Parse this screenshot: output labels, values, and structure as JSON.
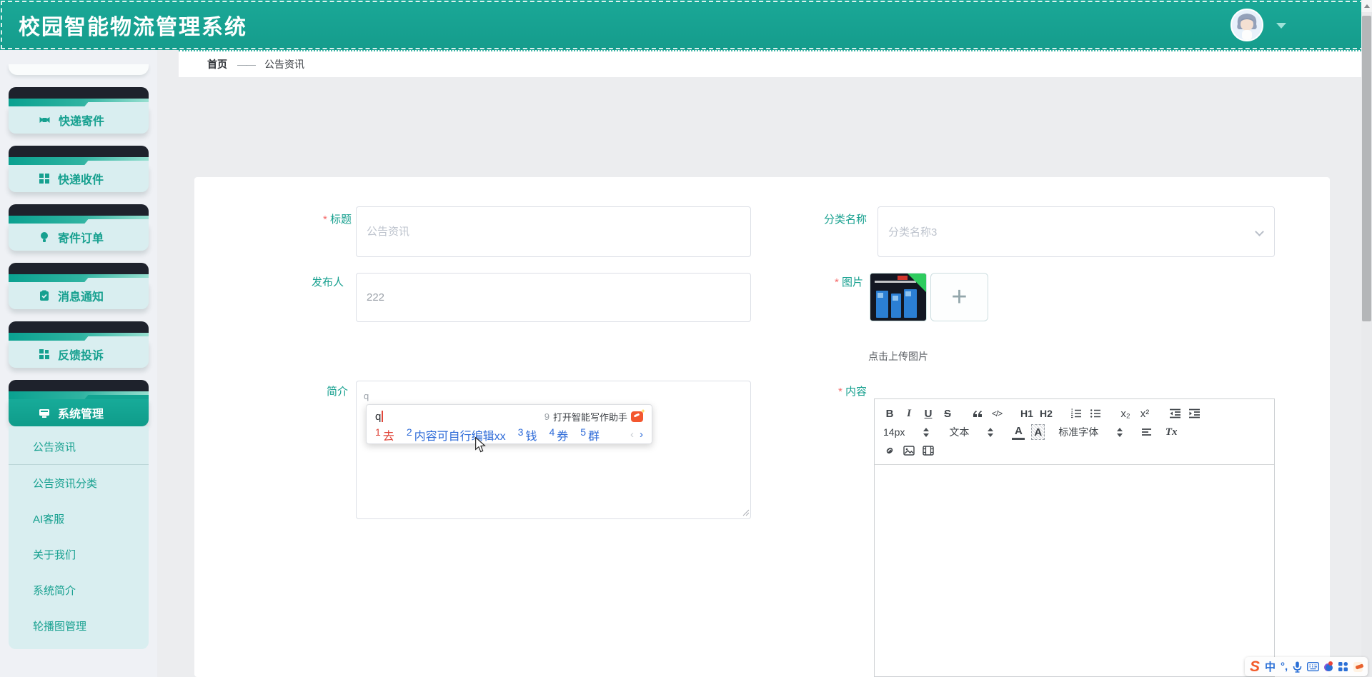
{
  "app": {
    "title": "校园智能物流管理系统"
  },
  "breadcrumb": {
    "home": "首页",
    "separator": "——",
    "current": "公告资讯"
  },
  "sidebar": {
    "items": [
      {
        "label": "快递寄件"
      },
      {
        "label": "快递收件"
      },
      {
        "label": "寄件订单"
      },
      {
        "label": "消息通知"
      },
      {
        "label": "反馈投诉"
      },
      {
        "label": "系统管理"
      }
    ],
    "submenu": [
      {
        "label": "公告资讯"
      },
      {
        "label": "公告资讯分类"
      },
      {
        "label": "AI客服"
      },
      {
        "label": "关于我们"
      },
      {
        "label": "系统简介"
      },
      {
        "label": "轮播图管理"
      }
    ]
  },
  "form": {
    "title": {
      "label": "标题",
      "placeholder": "公告资讯"
    },
    "category": {
      "label": "分类名称",
      "value": "分类名称3"
    },
    "publisher": {
      "label": "发布人",
      "value": "222"
    },
    "image": {
      "label": "图片",
      "hint": "点击上传图片",
      "add": "+"
    },
    "intro": {
      "label": "简介",
      "value": "q"
    },
    "content": {
      "label": "内容",
      "toolbar": {
        "bold": "B",
        "italic": "I",
        "underline": "U",
        "strike": "S",
        "code": "</>",
        "h1": "H1",
        "h2": "H2",
        "sub": "x₂",
        "sup": "x²",
        "size": "14px",
        "format": "文本",
        "font": "标准字体",
        "color_letter": "A",
        "bg_letter": "A",
        "clear": "Tx"
      }
    }
  },
  "ime": {
    "composition": "q",
    "assistant_index": "9",
    "assistant_label": "打开智能写作助手",
    "candidates": [
      {
        "index": "1",
        "text": "去"
      },
      {
        "index": "2",
        "text": "内容可自行编辑xx"
      },
      {
        "index": "3",
        "text": "钱"
      },
      {
        "index": "4",
        "text": "券"
      },
      {
        "index": "5",
        "text": "群"
      }
    ],
    "prev": "‹",
    "next": "›"
  },
  "taskbar": {
    "logo": "S",
    "lang": "中",
    "punct": "°,"
  },
  "colors": {
    "primary": "#14a392",
    "required_red": "#f56c6c",
    "candidate_blue": "#2e6bd8",
    "candidate_red": "#e0463a",
    "header_teal": "#18a291"
  }
}
